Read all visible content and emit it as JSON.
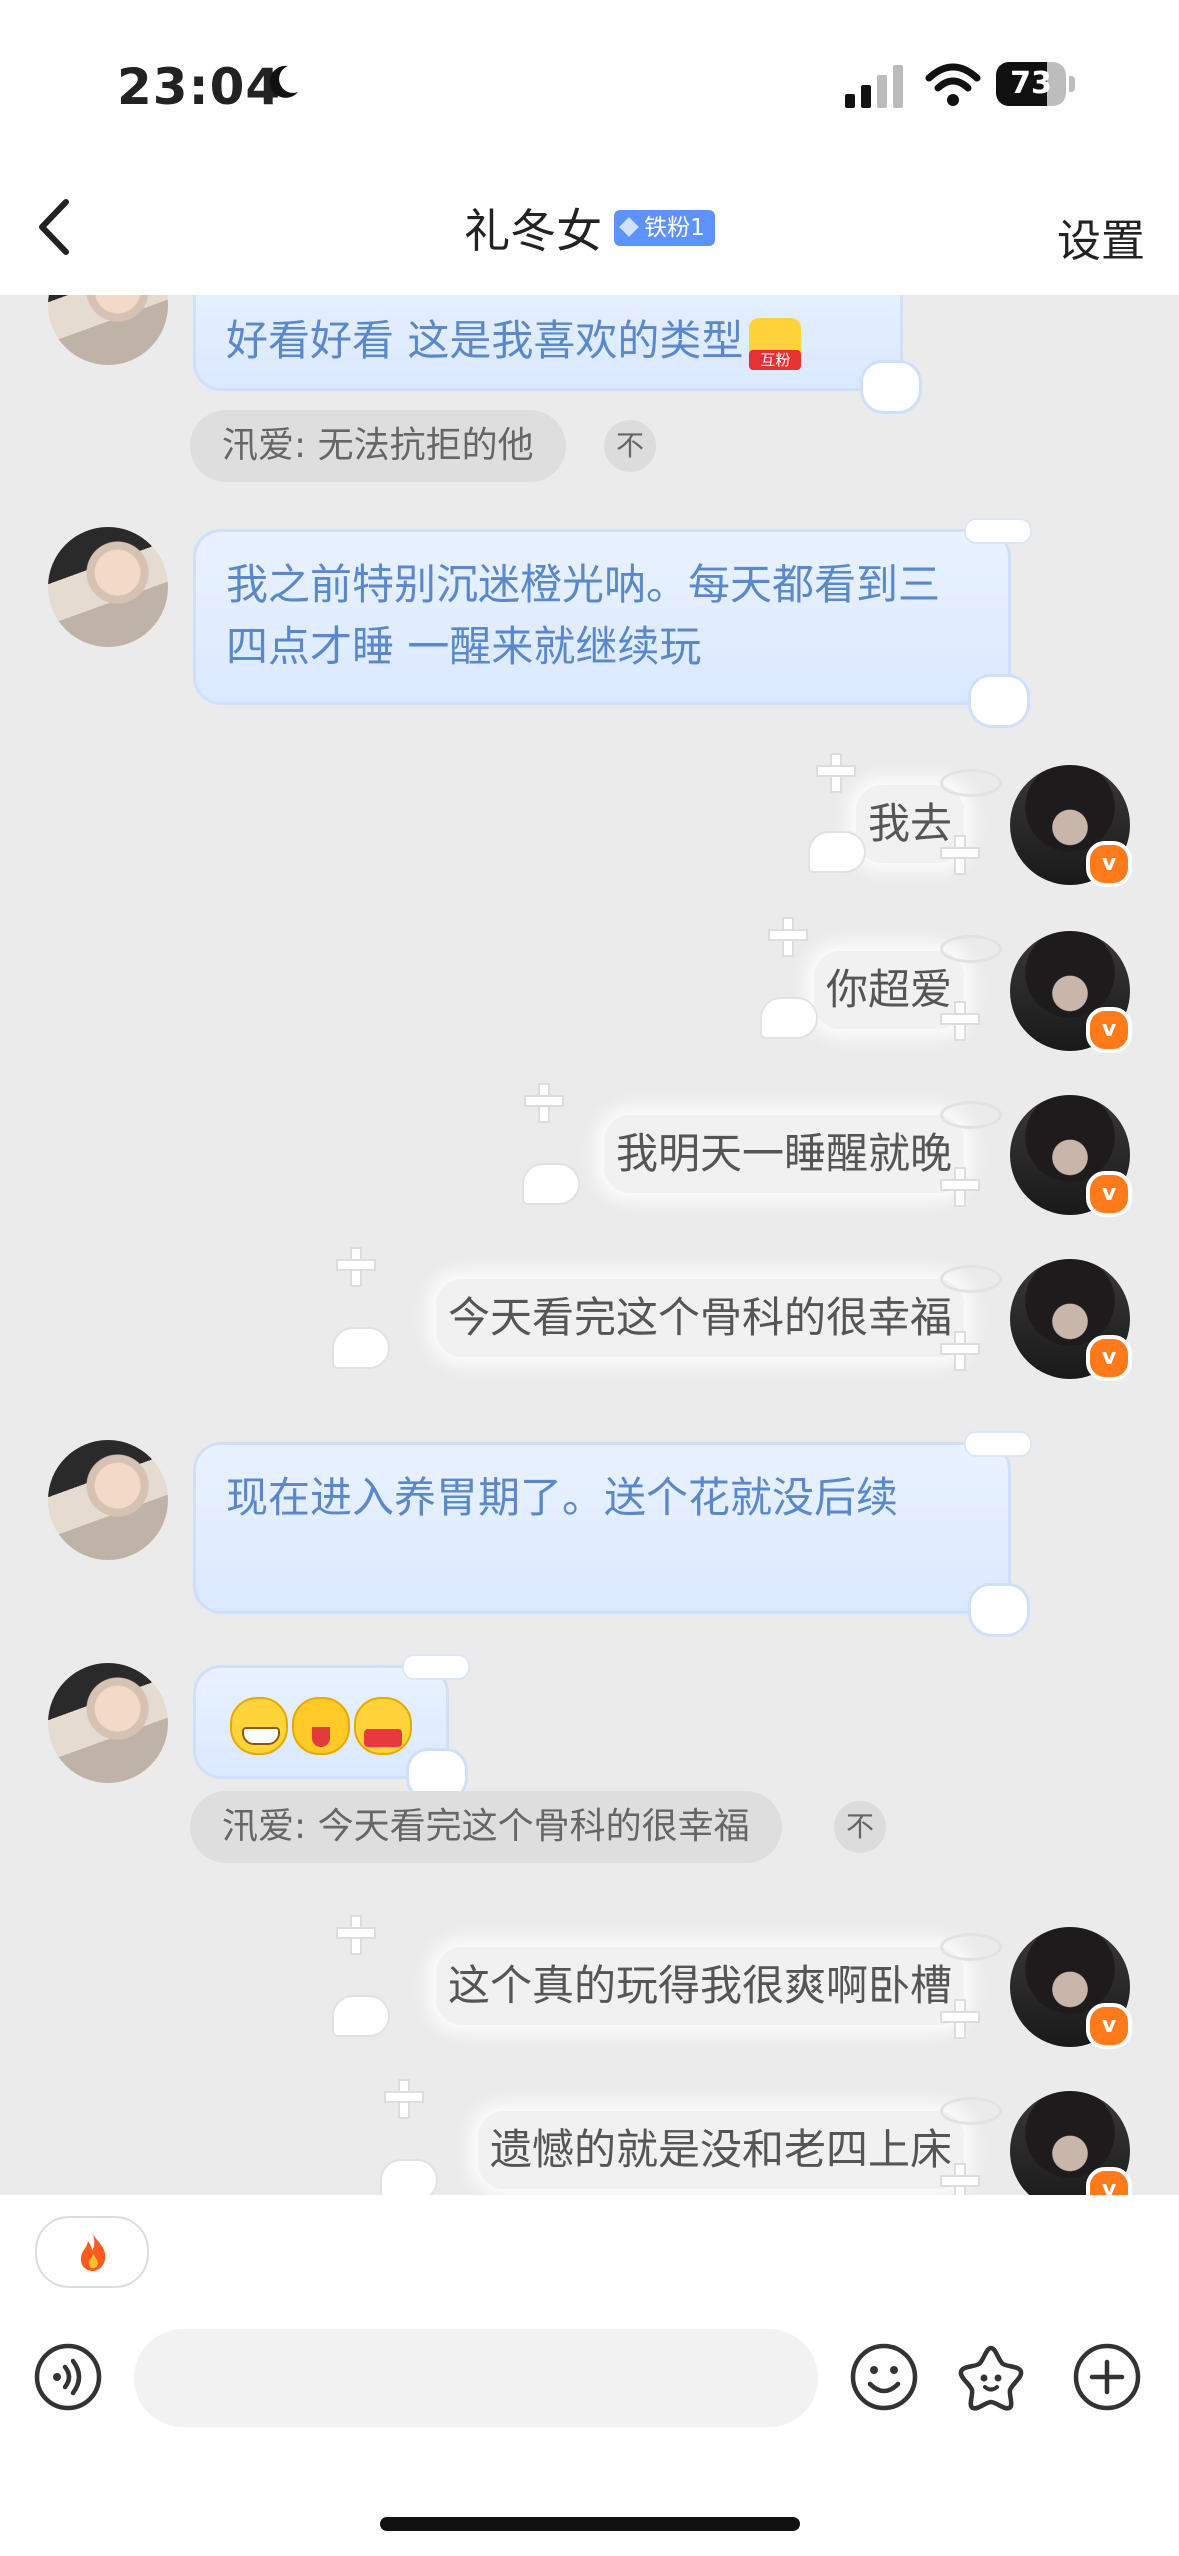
{
  "status_bar": {
    "time": "23:04",
    "battery": "73",
    "battery_level": 0.73
  },
  "header": {
    "title": "礼冬女",
    "fan_badge": "铁粉1",
    "settings_label": "设置"
  },
  "messages": [
    {
      "side": "in",
      "text": "好看好看 这是我喜欢的类型",
      "sticker": "互粉"
    },
    {
      "side": "quote",
      "text": "汛爱: 无法抗拒的他",
      "collapse": "不"
    },
    {
      "side": "in",
      "text": "我之前特别沉迷橙光呐。每天都看到三四点才睡 一醒来就继续玩"
    },
    {
      "side": "out",
      "text": "我去"
    },
    {
      "side": "out",
      "text": "你超爱"
    },
    {
      "side": "out",
      "text": "我明天一睡醒就晚"
    },
    {
      "side": "out",
      "text": "今天看完这个骨科的很幸福"
    },
    {
      "side": "in",
      "text": "现在进入养胃期了。送个花就没后续"
    },
    {
      "side": "in",
      "emojis": [
        "grin-icon",
        "tongue-icon",
        "shy-icon"
      ]
    },
    {
      "side": "quote",
      "text": "汛爱: 今天看完这个骨科的很幸福",
      "collapse": "不"
    },
    {
      "side": "out",
      "text": "这个真的玩得我很爽啊卧槽"
    },
    {
      "side": "out",
      "text": "遗憾的就是没和老四上床"
    }
  ],
  "avatar_badge": "v",
  "composer": {
    "hot_chip_icon": "flame-icon",
    "input_value": "",
    "input_placeholder": ""
  },
  "colors": {
    "incoming_text": "#5a88cc",
    "incoming_bubble": "#e3eeff",
    "badge": "#5c93ff",
    "vip": "#ff7a1a"
  }
}
